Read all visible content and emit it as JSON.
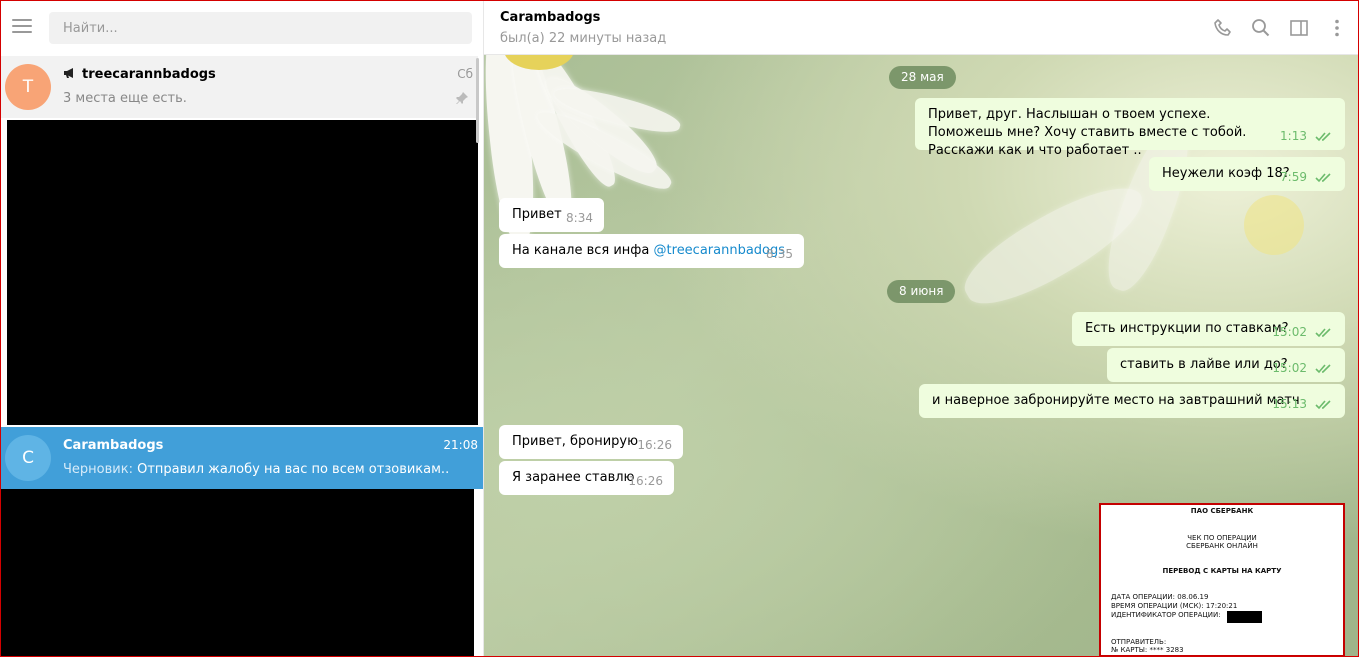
{
  "sidebar": {
    "search_placeholder": "Найти...",
    "chats": [
      {
        "avatar_letter": "T",
        "name": "treecarannbadogs",
        "time": "Сб",
        "preview": "3 места еще есть.",
        "type": "channel",
        "pinned": true
      },
      {
        "avatar_letter": "C",
        "name": "Carambadogs",
        "time": "21:08",
        "draft_label": "Черновик:",
        "preview": "Отправил жалобу на вас по всем отзовикам..",
        "active": true
      }
    ]
  },
  "chat": {
    "title": "Carambadogs",
    "status": "был(а) 22 минуты назад",
    "dates": [
      "28 мая",
      "8 июня"
    ],
    "messages": [
      {
        "dir": "out",
        "text": "Привет, друг. Наслышан о твоем успехе. Поможешь мне? Хочу ставить вместе с тобой. Расскажи как и что работает ..",
        "time": "1:13"
      },
      {
        "dir": "out",
        "text": "Неужели коэф 18?",
        "time": "7:59"
      },
      {
        "dir": "in",
        "text": "Привет",
        "time": "8:34"
      },
      {
        "dir": "in",
        "text": "На канале вся инфа",
        "link": "@treecarannbadogs",
        "time": "8:35"
      },
      {
        "dir": "out",
        "text": "Есть инструкции по ставкам?",
        "time": "15:02"
      },
      {
        "dir": "out",
        "text": "ставить в лайве или до?",
        "time": "15:02"
      },
      {
        "dir": "out",
        "text": "и наверное забронируйте место на завтрашний матч",
        "time": "15:13"
      },
      {
        "dir": "in",
        "text": "Привет, бронирую",
        "time": "16:26"
      },
      {
        "dir": "in",
        "text": "Я заранее ставлю",
        "time": "16:26"
      }
    ],
    "receipt": {
      "bank": "ПАО СБЕРБАНК",
      "title1": "ЧЕК ПО ОПЕРАЦИИ",
      "title2": "СБЕРБАНК ОНЛАЙН",
      "op": "ПЕРЕВОД С КАРТЫ НА КАРТУ",
      "date": "ДАТА ОПЕРАЦИИ: 08.06.19",
      "time": "ВРЕМЯ ОПЕРАЦИИ (МСК): 17:20:21",
      "id": "ИДЕНТИФИКАТОР ОПЕРАЦИИ:",
      "sender": "ОТПРАВИТЕЛЬ:",
      "card": "№ КАРТЫ: **** 3283"
    }
  },
  "colors": {
    "accent": "#419fd9",
    "out_bubble": "#effdde",
    "check": "#6cbb6c"
  }
}
